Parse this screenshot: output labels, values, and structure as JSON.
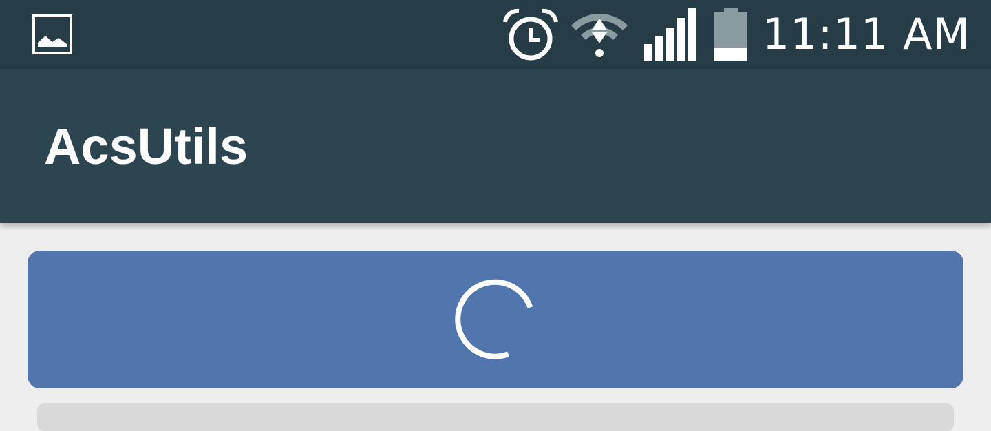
{
  "status_bar": {
    "time": "11:11 AM",
    "icons": [
      "image-notification-icon",
      "alarm-icon",
      "wifi-icon",
      "cell-signal-icon",
      "battery-icon"
    ]
  },
  "app_bar": {
    "title": "AcsUtils"
  },
  "colors": {
    "status_bar_bg": "#263c46",
    "app_bar_bg": "#2d4550",
    "card_bg": "#5076ad",
    "page_bg": "#eeeeee"
  },
  "content": {
    "cards": [
      {
        "state": "loading",
        "indicator": "spinner-icon"
      },
      {
        "state": "partially-visible"
      }
    ]
  }
}
